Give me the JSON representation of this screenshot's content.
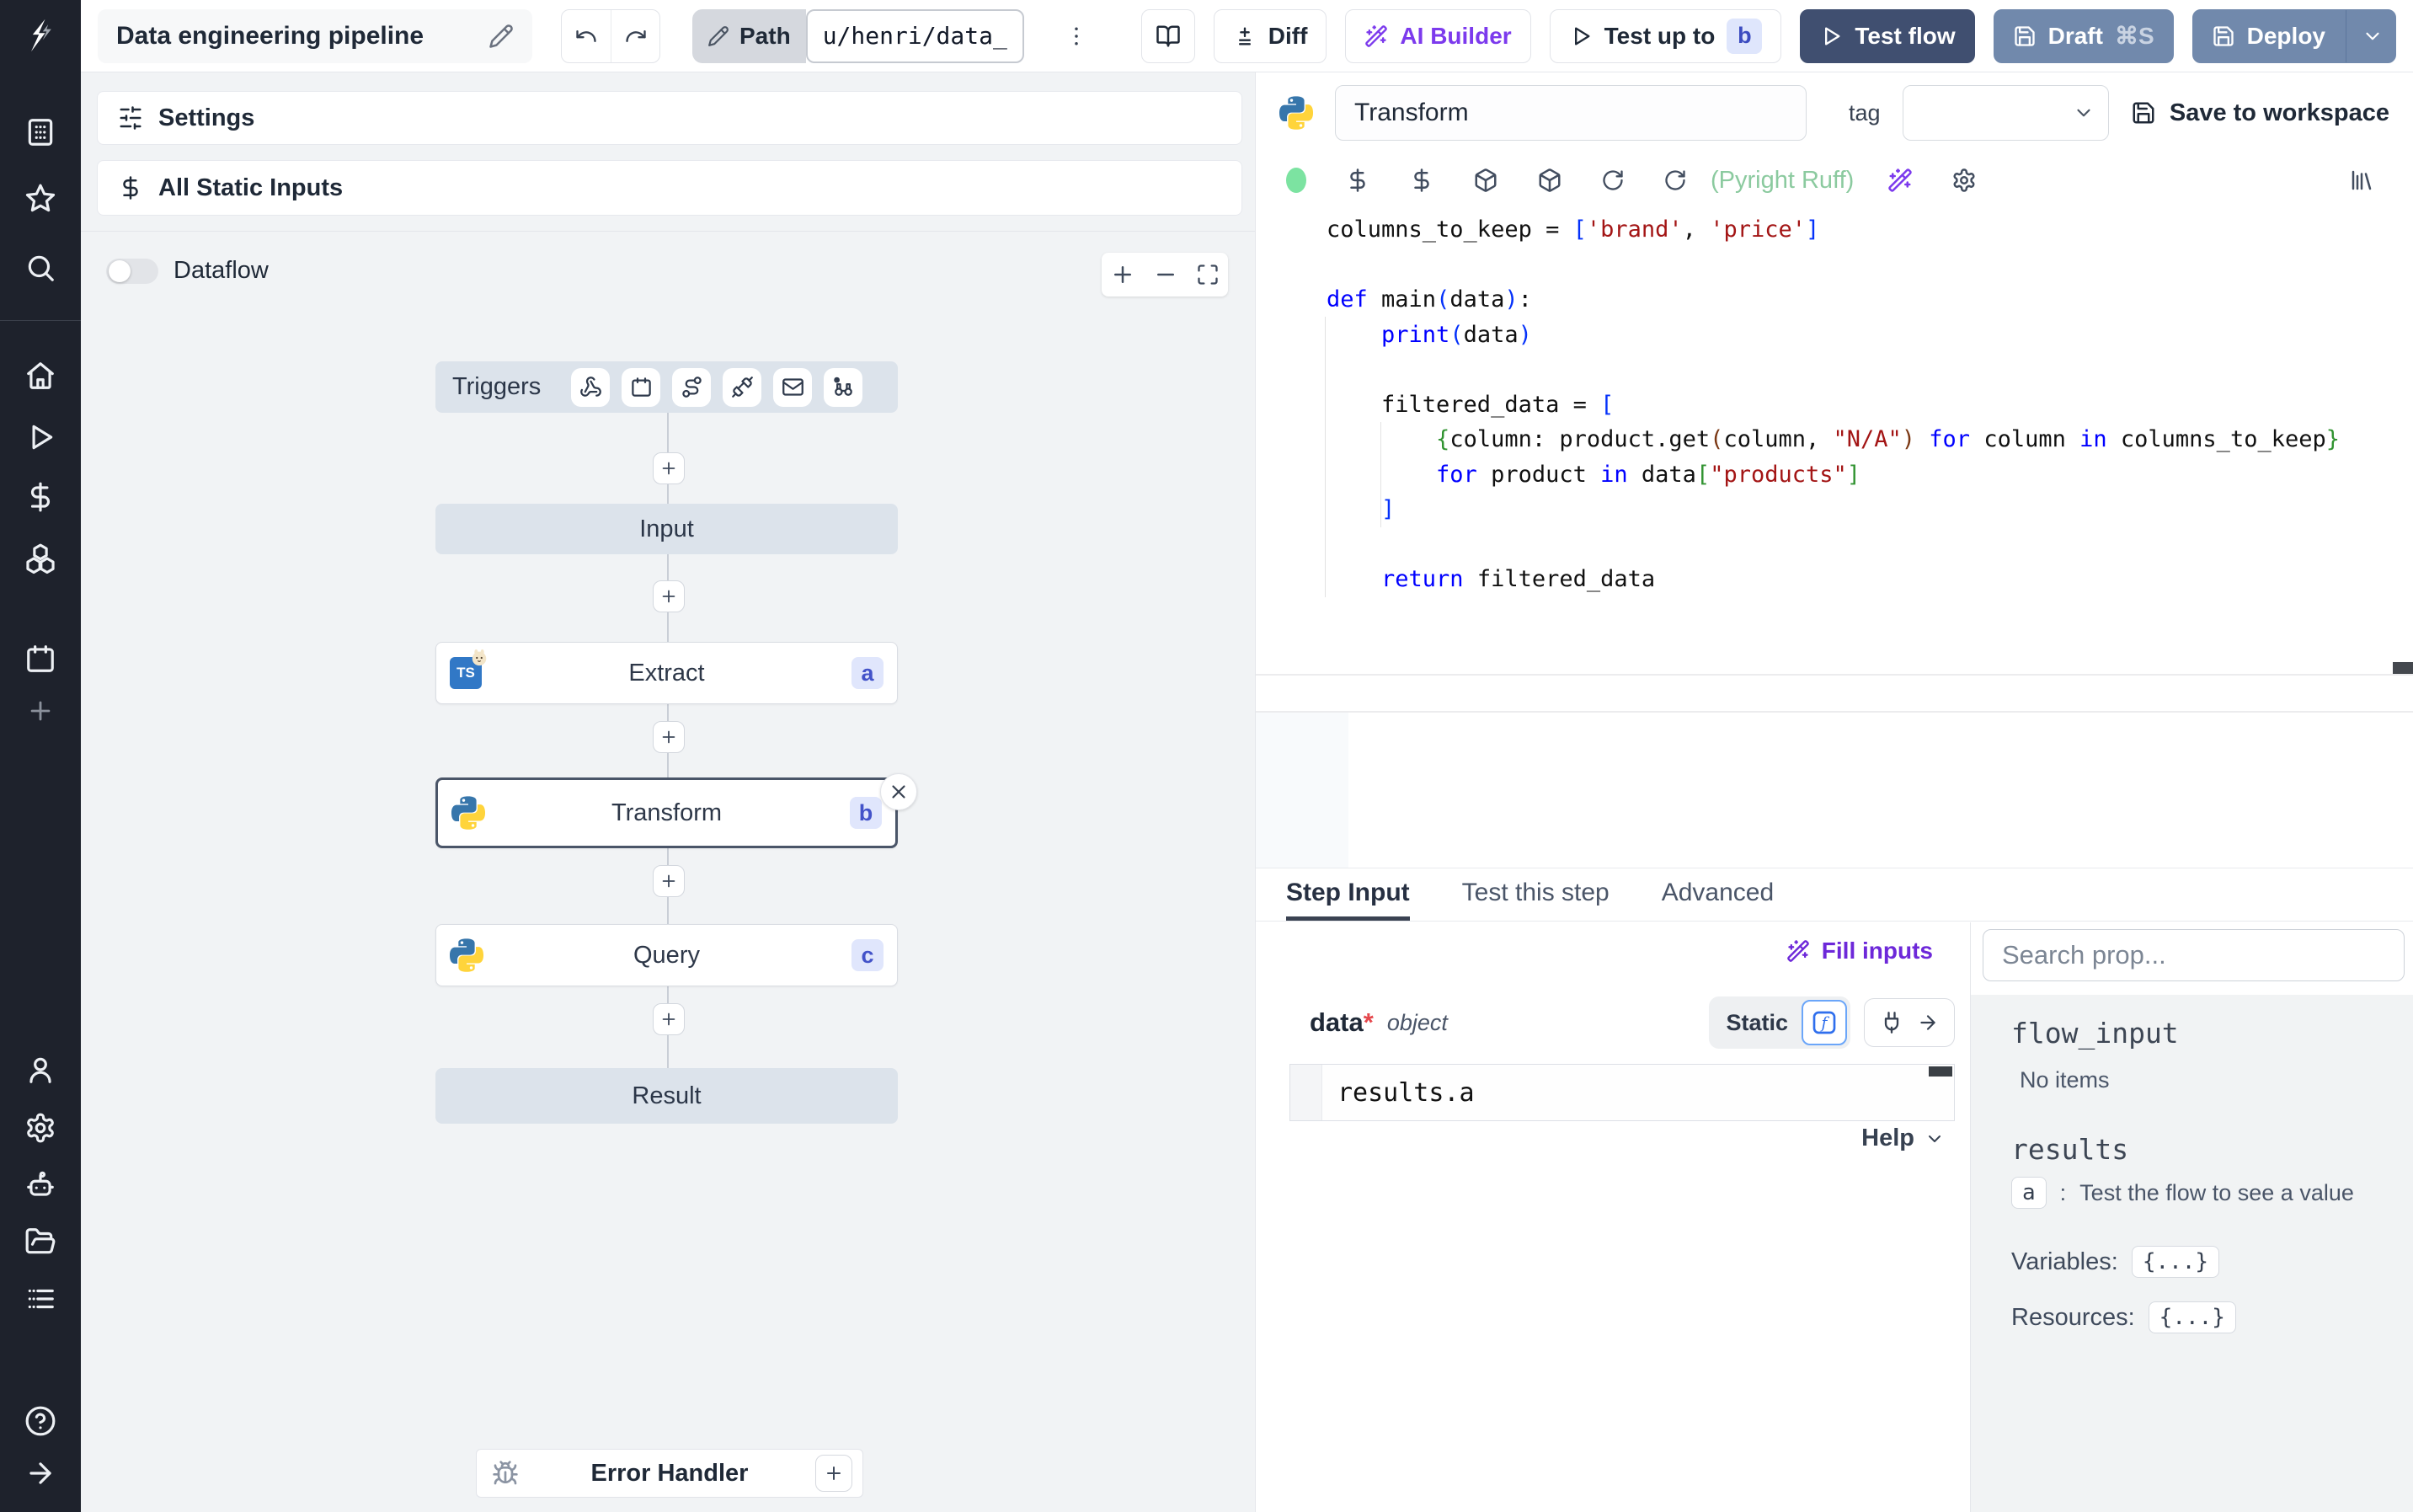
{
  "topbar": {
    "title": "Data engineering pipeline",
    "path_label": "Path",
    "path_value": "u/henri/data_",
    "diff_label": "Diff",
    "ai_builder_label": "AI Builder",
    "test_up_to_label": "Test up to",
    "test_up_to_badge": "b",
    "test_flow_label": "Test flow",
    "draft_label": "Draft",
    "draft_shortcut": "⌘S",
    "deploy_label": "Deploy"
  },
  "flow": {
    "settings_label": "Settings",
    "all_static_inputs_label": "All Static Inputs",
    "dataflow_label": "Dataflow",
    "triggers_label": "Triggers",
    "nodes": {
      "input": "Input",
      "extract": {
        "label": "Extract",
        "badge": "a"
      },
      "transform": {
        "label": "Transform",
        "badge": "b"
      },
      "query": {
        "label": "Query",
        "badge": "c"
      },
      "result": "Result",
      "error_handler": "Error Handler"
    }
  },
  "editor": {
    "step_name": "Transform",
    "tag_label": "tag",
    "save_to_workspace_label": "Save to workspace",
    "lint_label": "(Pyright Ruff)",
    "language": "python",
    "code_lines": [
      [
        [
          "t",
          "columns_to_keep = "
        ],
        [
          "b1",
          "["
        ],
        [
          "s",
          "'brand'"
        ],
        [
          "t",
          ", "
        ],
        [
          "s",
          "'price'"
        ],
        [
          "b1",
          "]"
        ]
      ],
      [],
      [
        [
          "k",
          "def"
        ],
        [
          "t",
          " main"
        ],
        [
          "b1",
          "("
        ],
        [
          "t",
          "data"
        ],
        [
          "b1",
          ")"
        ],
        [
          "t",
          ":"
        ]
      ],
      [
        [
          "t",
          "    "
        ],
        [
          "k",
          "print"
        ],
        [
          "b1",
          "("
        ],
        [
          "t",
          "data"
        ],
        [
          "b1",
          ")"
        ]
      ],
      [],
      [
        [
          "t",
          "    filtered_data = "
        ],
        [
          "b1",
          "["
        ]
      ],
      [
        [
          "t",
          "        "
        ],
        [
          "b2",
          "{"
        ],
        [
          "t",
          "column: product.get"
        ],
        [
          "b3",
          "("
        ],
        [
          "t",
          "column, "
        ],
        [
          "s",
          "\"N/A\""
        ],
        [
          "b3",
          ")"
        ],
        [
          "t",
          " "
        ],
        [
          "k",
          "for"
        ],
        [
          "t",
          " column "
        ],
        [
          "k",
          "in"
        ],
        [
          "t",
          " columns_to_keep"
        ],
        [
          "b2",
          "}"
        ]
      ],
      [
        [
          "t",
          "        "
        ],
        [
          "k",
          "for"
        ],
        [
          "t",
          " product "
        ],
        [
          "k",
          "in"
        ],
        [
          "t",
          " data"
        ],
        [
          "b2",
          "["
        ],
        [
          "s",
          "\"products\""
        ],
        [
          "b2",
          "]"
        ]
      ],
      [
        [
          "t",
          "    "
        ],
        [
          "b1",
          "]"
        ]
      ],
      [],
      [
        [
          "t",
          "    "
        ],
        [
          "k",
          "return"
        ],
        [
          "t",
          " filtered_data"
        ]
      ]
    ]
  },
  "step_panel": {
    "tabs": [
      {
        "label": "Step Input"
      },
      {
        "label": "Test this step"
      },
      {
        "label": "Advanced"
      }
    ],
    "fill_inputs_label": "Fill inputs",
    "arg_name": "data",
    "arg_required_mark": "*",
    "arg_type": "object",
    "static_label": "Static",
    "expression": "results.a",
    "help_label": "Help"
  },
  "props_panel": {
    "search_placeholder": "Search prop...",
    "flow_input_label": "flow_input",
    "no_items_label": "No items",
    "results_label": "results",
    "result_key": "a",
    "result_key_sep": ":",
    "result_hint": "Test the flow to see a value",
    "variables_label": "Variables:",
    "variables_value": "{...}",
    "resources_label": "Resources:",
    "resources_value": "{...}"
  },
  "colors": {
    "accent_purple": "#7c3aed",
    "test_flow_button": "#404f70",
    "deploy_button": "#7189ac",
    "node_badge_bg": "#e0e6fc",
    "node_badge_text": "#4353c9",
    "lint_green": "#8bca9f",
    "status_green": "#7ce3a1",
    "sidebar_bg": "#1e222c",
    "canvas_bg": "#f1f3f5",
    "node_bar_bg": "#dce3eb",
    "python_blue": "#3776ab",
    "python_yellow": "#ffd43b",
    "code_keyword": "#0000ff",
    "code_string": "#a31515"
  },
  "icons": [
    "windmill-logo",
    "workspace",
    "favorites",
    "search",
    "home",
    "runs",
    "variables",
    "resources",
    "schedules",
    "add",
    "user",
    "settings",
    "workers",
    "folders",
    "logs",
    "help",
    "expand-sidebar",
    "pencil",
    "undo",
    "redo",
    "kebab-menu",
    "docs-book",
    "diff",
    "ai-wand",
    "play",
    "save",
    "chevron-down",
    "sliders",
    "dollar",
    "webhook",
    "schedule",
    "route",
    "websocket",
    "email",
    "poll",
    "python",
    "typescript-bun",
    "bug",
    "close",
    "package",
    "reload",
    "library",
    "function",
    "plug",
    "arrow-right",
    "zoom-in",
    "zoom-out",
    "fit-view"
  ]
}
